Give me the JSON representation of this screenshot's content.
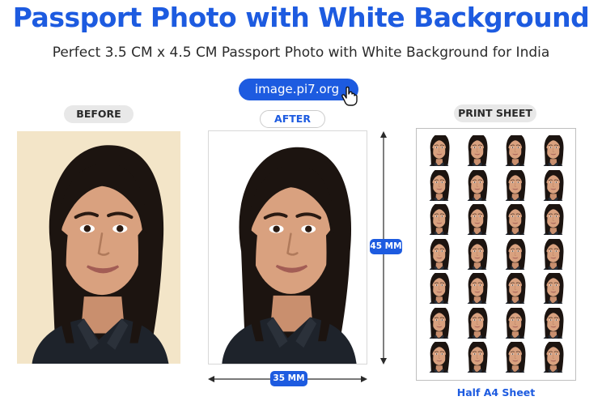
{
  "header": {
    "title": "Passport Photo with White Background",
    "subtitle": "Perfect 3.5 CM x 4.5 CM Passport Photo with White Background for India"
  },
  "site_button": {
    "label": "image.pi7.org"
  },
  "panels": {
    "before_label": "BEFORE",
    "after_label": "AFTER",
    "print_label": "PRINT SHEET"
  },
  "dimensions": {
    "height": "45 MM",
    "width": "35 MM"
  },
  "footer": {
    "sheet_label": "Half A4 Sheet"
  },
  "print_sheet": {
    "rows": 7,
    "columns": 4
  },
  "colors": {
    "accent": "#1d5be0",
    "before_background": "#f3e5c8",
    "after_background": "#ffffff"
  }
}
